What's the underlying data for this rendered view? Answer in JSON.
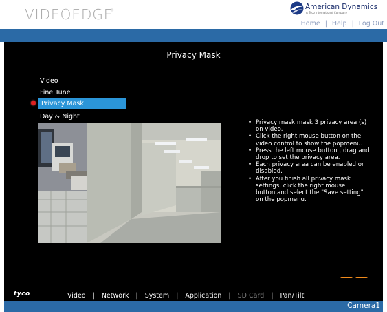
{
  "header": {
    "product_logo": "VideoEdge",
    "brand_name": "American Dynamics",
    "brand_tagline": "A Tyco International Company",
    "links": [
      "Home",
      "Help",
      "Log Out"
    ]
  },
  "page": {
    "title": "Privacy Mask"
  },
  "menu": {
    "items": [
      {
        "label": "Video",
        "selected": false
      },
      {
        "label": "Fine Tune",
        "selected": false
      },
      {
        "label": "Privacy Mask",
        "selected": true
      },
      {
        "label": "Day & Night",
        "selected": false
      }
    ]
  },
  "instructions": [
    "Privacy mask:mask 3 privacy area (s) on video.",
    "Click the right mouse button on the video control to show the popmenu.",
    "Press the left mouse button , drag and drop to set the privacy area.",
    "Each privacy area can be enabled or disabled.",
    "After you finish all privacy mask settings, click the right mouse button,and select the \"Save setting\" on the popmenu."
  ],
  "actions": {
    "back_icon": "arrow-left-icon",
    "refresh_icon": "refresh-icon",
    "color": "#f08a1c"
  },
  "footer": {
    "brand": "tyco",
    "nav": [
      {
        "label": "Video",
        "enabled": true
      },
      {
        "label": "Network",
        "enabled": true
      },
      {
        "label": "System",
        "enabled": true
      },
      {
        "label": "Application",
        "enabled": true
      },
      {
        "label": "SD Card",
        "enabled": false
      },
      {
        "label": "Pan/Tilt",
        "enabled": true
      }
    ],
    "camera_label": "Camera1"
  },
  "colors": {
    "accent_blue": "#2b6aa6",
    "selection_blue": "#2b95d8",
    "background": "#000000"
  }
}
